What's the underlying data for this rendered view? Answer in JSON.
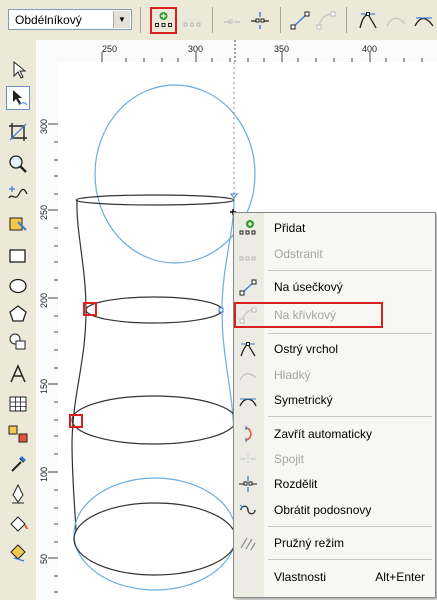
{
  "property_bar": {
    "shape_mode_value": "Obdélníkový",
    "dropdown_arrow": "▼"
  },
  "ruler": {
    "h_ticks": [
      "250",
      "300",
      "350",
      "400"
    ],
    "v_ticks": [
      "300",
      "250",
      "200",
      "150",
      "100",
      "50"
    ]
  },
  "context_menu": {
    "items": [
      {
        "label": "Přidat",
        "icon": "add-node-icon",
        "enabled": true
      },
      {
        "label": "Odstranit",
        "icon": "delete-node-icon",
        "enabled": false
      },
      {
        "label": "Na úsečkový",
        "icon": "to-line-icon",
        "enabled": true
      },
      {
        "label": "Na křivkový",
        "icon": "to-curve-icon",
        "enabled": false
      },
      {
        "label": "Ostrý vrchol",
        "icon": "cusp-node-icon",
        "enabled": true
      },
      {
        "label": "Hladký",
        "icon": "smooth-node-icon",
        "enabled": false
      },
      {
        "label": "Symetrický",
        "icon": "symmetric-node-icon",
        "enabled": true
      },
      {
        "label": "Zavřít automaticky",
        "icon": "auto-close-icon",
        "enabled": true
      },
      {
        "label": "Spojit",
        "icon": "join-nodes-icon",
        "enabled": false
      },
      {
        "label": "Rozdělit",
        "icon": "break-apart-icon",
        "enabled": true
      },
      {
        "label": "Obrátit podosnovy",
        "icon": "reverse-direction-icon",
        "enabled": true
      },
      {
        "label": "Pružný režim",
        "icon": "elastic-mode-icon",
        "enabled": true
      },
      {
        "label": "Vlastnosti",
        "shortcut": "Alt+Enter",
        "enabled": true
      }
    ]
  },
  "colors": {
    "highlight_red": "#d82020",
    "curve_blue": "#6aaee0",
    "node_green": "#2aa02a"
  }
}
